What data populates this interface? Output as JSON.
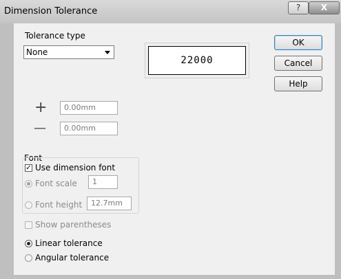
{
  "window": {
    "title": "Dimension Tolerance",
    "help_glyph": "?",
    "close_glyph": "X"
  },
  "tolerance_type": {
    "label": "Tolerance type",
    "selected": "None"
  },
  "preview": {
    "value": "22000"
  },
  "buttons": {
    "ok": "OK",
    "cancel": "Cancel",
    "help": "Help"
  },
  "limits": {
    "plus_symbol": "+",
    "plus_value": "0.00mm",
    "minus_symbol": "—",
    "minus_value": "0.00mm"
  },
  "font_group": {
    "label": "Font",
    "use_dimension_font": {
      "label": "Use dimension font",
      "checked": true
    },
    "font_scale": {
      "label": "Font scale",
      "value": "1",
      "selected": true,
      "enabled": false
    },
    "font_height": {
      "label": "Font height",
      "value": "12.7mm",
      "selected": false,
      "enabled": false
    }
  },
  "show_parentheses": {
    "label": "Show parentheses",
    "checked": false,
    "enabled": false
  },
  "tolerance_mode": {
    "linear": {
      "label": "Linear tolerance",
      "selected": true
    },
    "angular": {
      "label": "Angular tolerance",
      "selected": false
    }
  }
}
